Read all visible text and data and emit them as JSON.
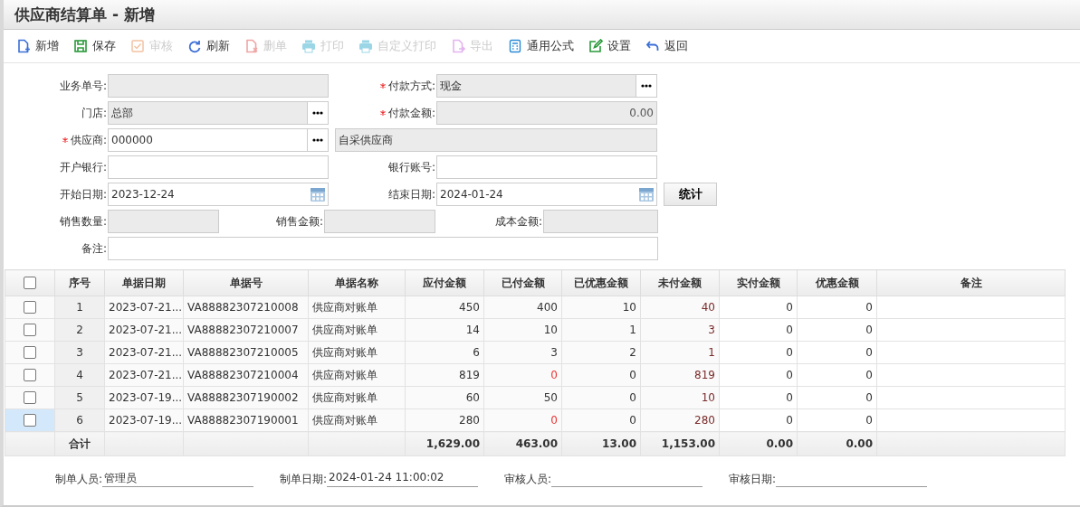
{
  "title": "供应商结算单 - 新增",
  "toolbar": [
    {
      "label": "新增",
      "kind": "new",
      "disabled": false
    },
    {
      "label": "保存",
      "kind": "save",
      "disabled": false
    },
    {
      "label": "审核",
      "kind": "check",
      "disabled": true
    },
    {
      "label": "刷新",
      "kind": "refresh",
      "disabled": false
    },
    {
      "label": "删单",
      "kind": "delete",
      "disabled": true
    },
    {
      "label": "打印",
      "kind": "print",
      "disabled": true
    },
    {
      "label": "自定义打印",
      "kind": "print",
      "disabled": true
    },
    {
      "label": "导出",
      "kind": "export",
      "disabled": true
    },
    {
      "label": "通用公式",
      "kind": "calc",
      "disabled": false
    },
    {
      "label": "设置",
      "kind": "edit",
      "disabled": false
    },
    {
      "label": "返回",
      "kind": "back",
      "disabled": false
    }
  ],
  "form_rows": [
    [
      {
        "label": "业务单号:",
        "required": false,
        "readonly": true,
        "picker": false
      },
      {
        "label": "付款方式:",
        "required": true,
        "value": "现金",
        "readonly": true,
        "picker": true
      }
    ],
    [
      {
        "label": "门店:",
        "required": false,
        "value": "总部",
        "readonly": true,
        "picker": true
      },
      {
        "label": "付款金额:",
        "required": true,
        "value": "0.00",
        "readonly": true,
        "picker": false,
        "kind": "amount"
      }
    ],
    [
      {
        "label": "供应商:",
        "required": true,
        "value": "000000",
        "readonly": false,
        "picker": true,
        "extra": "自采供应商"
      }
    ],
    [
      {
        "label": "开户银行:",
        "required": false,
        "readonly": false,
        "picker": false
      },
      {
        "label": "银行账号:",
        "required": false,
        "readonly": false,
        "picker": false
      }
    ],
    [
      {
        "label": "开始日期:",
        "required": false,
        "value": "2023-12-24",
        "readonly": false,
        "picker": false,
        "kind": "date"
      },
      {
        "label": "结束日期:",
        "required": false,
        "value": "2024-01-24",
        "readonly": false,
        "picker": false,
        "kind": "date",
        "button": "统计"
      }
    ]
  ],
  "summary_fields": [
    {
      "label": "销售数量:"
    },
    {
      "label": "销售金额:"
    },
    {
      "label": "成本金额:"
    }
  ],
  "remark": {
    "label": "备注:"
  },
  "table": {
    "all_checked": false,
    "columns": [
      "序号",
      "单据日期",
      "单据号",
      "单据名称",
      "应付金额",
      "已付金额",
      "已优惠金额",
      "未付金额",
      "实付金额",
      "优惠金额",
      "备注"
    ],
    "rows": [
      {
        "checked": false,
        "selected": false,
        "paid_alert": false,
        "cells": [
          "1",
          "2023-07-21...",
          "VA88882307210008",
          "供应商对账单",
          "450",
          "400",
          "10",
          "40",
          "0",
          "0"
        ]
      },
      {
        "checked": false,
        "selected": false,
        "paid_alert": false,
        "cells": [
          "2",
          "2023-07-21...",
          "VA88882307210007",
          "供应商对账单",
          "14",
          "10",
          "1",
          "3",
          "0",
          "0"
        ]
      },
      {
        "checked": false,
        "selected": false,
        "paid_alert": false,
        "cells": [
          "3",
          "2023-07-21...",
          "VA88882307210005",
          "供应商对账单",
          "6",
          "3",
          "2",
          "1",
          "0",
          "0"
        ]
      },
      {
        "checked": false,
        "selected": false,
        "paid_alert": true,
        "cells": [
          "4",
          "2023-07-21...",
          "VA88882307210004",
          "供应商对账单",
          "819",
          "0",
          "0",
          "819",
          "0",
          "0"
        ]
      },
      {
        "checked": false,
        "selected": false,
        "paid_alert": false,
        "cells": [
          "5",
          "2023-07-19...",
          "VA88882307190002",
          "供应商对账单",
          "60",
          "50",
          "0",
          "10",
          "0",
          "0"
        ]
      },
      {
        "checked": false,
        "selected": true,
        "paid_alert": true,
        "cells": [
          "6",
          "2023-07-19...",
          "VA88882307190001",
          "供应商对账单",
          "280",
          "0",
          "0",
          "280",
          "0",
          "0"
        ]
      }
    ],
    "totals": {
      "label": "合计",
      "values": [
        "1,629.00",
        "463.00",
        "13.00",
        "1,153.00",
        "0.00",
        "0.00"
      ]
    }
  },
  "footer": [
    {
      "label": "制单人员:",
      "value": "管理员"
    },
    {
      "label": "制单日期:",
      "value": "2024-01-24 11:00:02"
    },
    {
      "label": "审核人员:"
    },
    {
      "label": "审核日期:"
    }
  ]
}
